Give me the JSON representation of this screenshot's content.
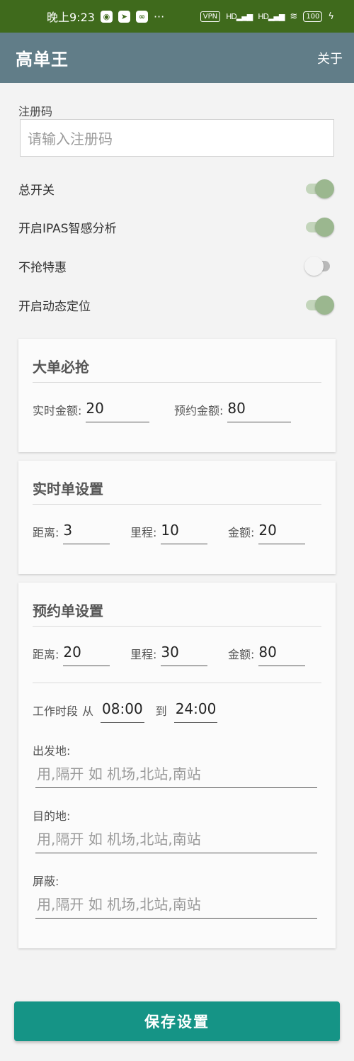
{
  "status_bar": {
    "time": "晚上9:23",
    "more": "···",
    "vpn": "VPN",
    "signal1": "HD",
    "signal2": "HD",
    "battery": "100"
  },
  "header": {
    "title": "高单王",
    "about_label": "关于"
  },
  "registration": {
    "label": "注册码",
    "placeholder": "请输入注册码"
  },
  "switches": [
    {
      "label": "总开关",
      "on": true
    },
    {
      "label": "开启IPAS智感分析",
      "on": true
    },
    {
      "label": "不抢特惠",
      "on": false
    },
    {
      "label": "开启动态定位",
      "on": true
    }
  ],
  "big_order": {
    "title": "大单必抢",
    "realtime_amount_label": "实时金额:",
    "realtime_amount": "20",
    "reserve_amount_label": "预约金额:",
    "reserve_amount": "80"
  },
  "realtime_settings": {
    "title": "实时单设置",
    "distance_label": "距离:",
    "distance": "3",
    "mileage_label": "里程:",
    "mileage": "10",
    "amount_label": "金额:",
    "amount": "20"
  },
  "reserve_settings": {
    "title": "预约单设置",
    "distance_label": "距离:",
    "distance": "20",
    "mileage_label": "里程:",
    "mileage": "30",
    "amount_label": "金额:",
    "amount": "80",
    "work_period_label": "工作时段",
    "from_label": "从",
    "start_time": "08:00",
    "to_label": "到",
    "end_time": "24:00",
    "departure_label": "出发地:",
    "departure_placeholder": "用,隔开 如 机场,北站,南站",
    "destination_label": "目的地:",
    "destination_placeholder": "用,隔开 如 机场,北站,南站",
    "block_label": "屏蔽:",
    "block_placeholder": "用,隔开 如 机场,北站,南站"
  },
  "save_button": {
    "label": "保存设置"
  },
  "colors": {
    "status_bar": "#3f6a1c",
    "app_bar": "#617d88",
    "toggle_on": "#9bb78f",
    "save_button": "#159486"
  }
}
